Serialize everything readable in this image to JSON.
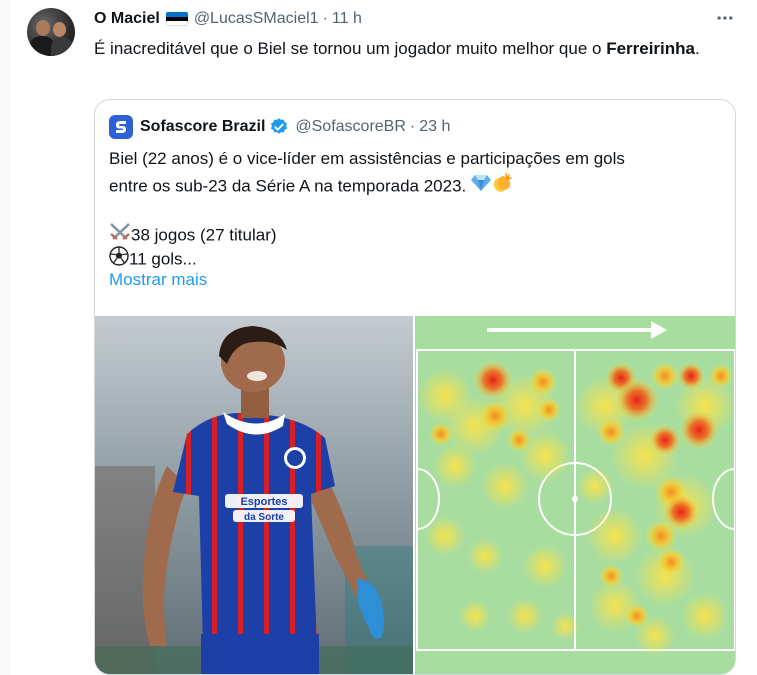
{
  "tweet": {
    "author_name": "O Maciel",
    "flag_icon": "estonia-flag-icon",
    "flag_colors": [
      "#0072ce",
      "#000000",
      "#ffffff"
    ],
    "handle": "@LucasSMaciel1",
    "separator": "·",
    "time": "11 h",
    "text_part1": "É inacreditável que o Biel se tornou um jogador muito melhor que o ",
    "text_bold": "Ferreirinha",
    "text_part2": "."
  },
  "quote": {
    "author_name": "Sofascore Brazil",
    "verified_color": "#1d9bf0",
    "handle": "@SofascoreBR",
    "separator": "·",
    "time": "23 h",
    "line1": "Biel (22 anos) é o vice-líder em assistências e participações em gols",
    "line2": "entre os sub-23 da Série A na temporada 2023. ",
    "line2_emojis": [
      "gem-emoji",
      "clapping-hands-emoji"
    ],
    "line3": "38 jogos (27 titular)",
    "line3_emoji": "crossed-swords-emoji",
    "line4": "11 gols...",
    "line4_emoji": "soccer-ball-emoji",
    "show_more": "Mostrar mais",
    "show_more_color": "#1d9bf0"
  },
  "media": {
    "photo_sponsor": "Esportes da Sorte",
    "heatmap_arrow": "attack-direction-arrow"
  }
}
